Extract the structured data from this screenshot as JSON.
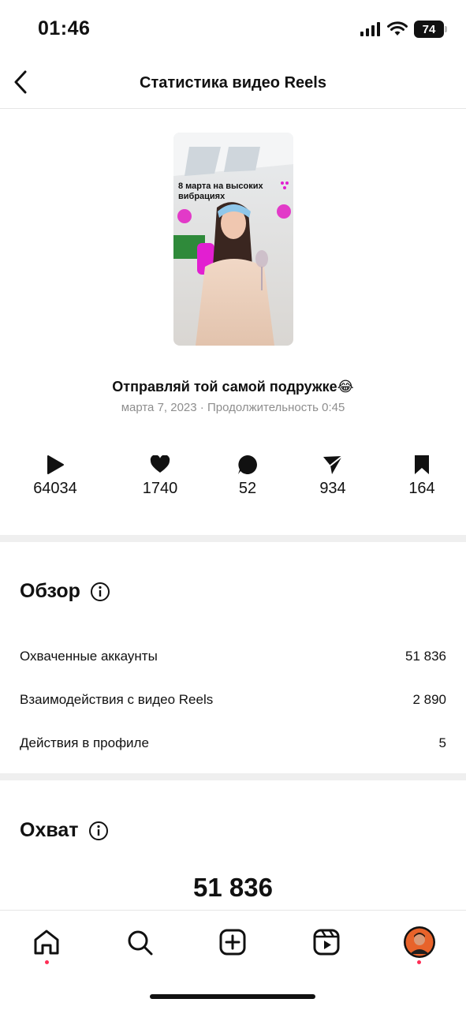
{
  "status_bar": {
    "time": "01:46",
    "battery": "74"
  },
  "header": {
    "title": "Статистика видео Reels"
  },
  "reel": {
    "thumbnail_caption": "8 марта на высоких вибрациях",
    "title": "Отправляй той самой подружке😂",
    "meta": "марта 7, 2023 · Продолжительность 0:45"
  },
  "metrics": [
    {
      "icon": "play-icon",
      "value": "64034"
    },
    {
      "icon": "heart-icon",
      "value": "1740"
    },
    {
      "icon": "comment-icon",
      "value": "52"
    },
    {
      "icon": "share-icon",
      "value": "934"
    },
    {
      "icon": "bookmark-icon",
      "value": "164"
    }
  ],
  "overview": {
    "title": "Обзор",
    "rows": [
      {
        "label": "Охваченные аккаунты",
        "value": "51 836"
      },
      {
        "label": "Взаимодействия с видео Reels",
        "value": "2 890"
      },
      {
        "label": "Действия в профиле",
        "value": "5"
      }
    ]
  },
  "reach": {
    "title": "Охват",
    "value": "51 836"
  },
  "tabs": [
    {
      "name": "home",
      "icon": "home-icon"
    },
    {
      "name": "search",
      "icon": "search-icon"
    },
    {
      "name": "create",
      "icon": "plus-square-icon"
    },
    {
      "name": "reels",
      "icon": "reels-icon"
    },
    {
      "name": "profile",
      "icon": "avatar"
    }
  ],
  "colors": {
    "accent_dot": "#ff2d55",
    "divider": "#efefef",
    "meta_text": "#8e8e8e"
  }
}
